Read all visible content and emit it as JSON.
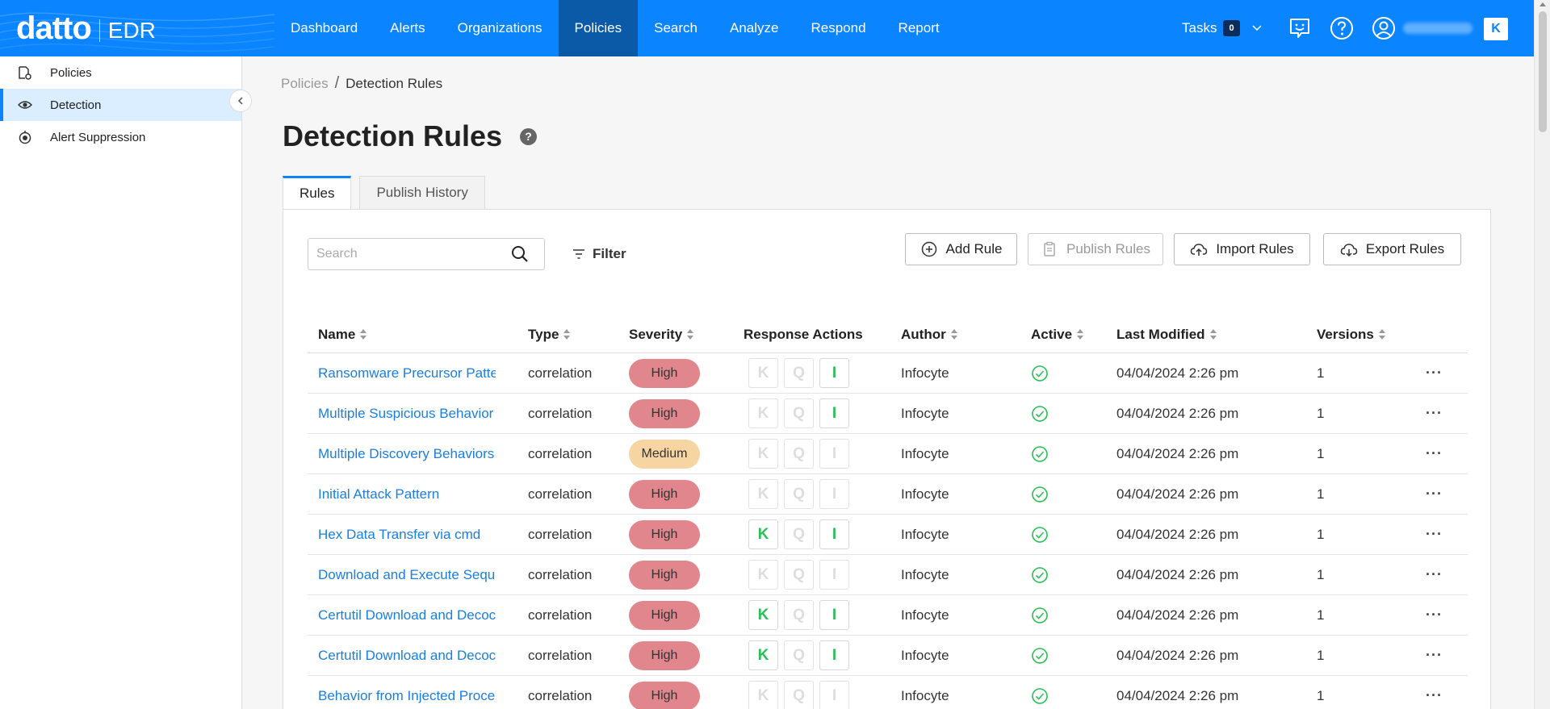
{
  "app": {
    "brand": "datto",
    "product": "EDR"
  },
  "nav": [
    {
      "label": "Dashboard"
    },
    {
      "label": "Alerts"
    },
    {
      "label": "Organizations"
    },
    {
      "label": "Policies"
    },
    {
      "label": "Search"
    },
    {
      "label": "Analyze"
    },
    {
      "label": "Respond"
    },
    {
      "label": "Report"
    }
  ],
  "tasks": {
    "label": "Tasks",
    "count": "0"
  },
  "corner_logo": "K",
  "sidebar": {
    "items": [
      {
        "label": "Policies",
        "icon": "policy-icon"
      },
      {
        "label": "Detection",
        "icon": "eye-icon"
      },
      {
        "label": "Alert Suppression",
        "icon": "suppression-icon"
      }
    ]
  },
  "breadcrumb": {
    "parent": "Policies",
    "separator": "/",
    "current": "Detection Rules"
  },
  "page": {
    "title": "Detection Rules",
    "help": "?"
  },
  "tabs": [
    {
      "label": "Rules"
    },
    {
      "label": "Publish History"
    }
  ],
  "toolbar": {
    "search_placeholder": "Search",
    "filter_label": "Filter",
    "add_rule": "Add Rule",
    "publish_rules": "Publish Rules",
    "import_rules": "Import Rules",
    "export_rules": "Export Rules"
  },
  "table": {
    "columns": {
      "name": "Name",
      "type": "Type",
      "severity": "Severity",
      "response": "Response Actions",
      "author": "Author",
      "active": "Active",
      "modified": "Last Modified",
      "versions": "Versions"
    },
    "response_letters": [
      "K",
      "Q",
      "I"
    ],
    "more": "···",
    "rows": [
      {
        "name": "Ransomware Precursor Patte",
        "type": "correlation",
        "severity": "High",
        "author": "Infocyte",
        "modified": "04/04/2024 2:26 pm",
        "versions": "1"
      },
      {
        "name": "Multiple Suspicious Behavior",
        "type": "correlation",
        "severity": "High",
        "author": "Infocyte",
        "modified": "04/04/2024 2:26 pm",
        "versions": "1"
      },
      {
        "name": "Multiple Discovery Behaviors",
        "type": "correlation",
        "severity": "Medium",
        "author": "Infocyte",
        "modified": "04/04/2024 2:26 pm",
        "versions": "1"
      },
      {
        "name": "Initial Attack Pattern",
        "type": "correlation",
        "severity": "High",
        "author": "Infocyte",
        "modified": "04/04/2024 2:26 pm",
        "versions": "1"
      },
      {
        "name": "Hex Data Transfer via cmd",
        "type": "correlation",
        "severity": "High",
        "author": "Infocyte",
        "modified": "04/04/2024 2:26 pm",
        "versions": "1"
      },
      {
        "name": "Download and Execute Sequ",
        "type": "correlation",
        "severity": "High",
        "author": "Infocyte",
        "modified": "04/04/2024 2:26 pm",
        "versions": "1"
      },
      {
        "name": "Certutil Download and Decoc",
        "type": "correlation",
        "severity": "High",
        "author": "Infocyte",
        "modified": "04/04/2024 2:26 pm",
        "versions": "1"
      },
      {
        "name": "Certutil Download and Decoc",
        "type": "correlation",
        "severity": "High",
        "author": "Infocyte",
        "modified": "04/04/2024 2:26 pm",
        "versions": "1"
      },
      {
        "name": "Behavior from Injected Proce",
        "type": "correlation",
        "severity": "High",
        "author": "Infocyte",
        "modified": "04/04/2024 2:26 pm",
        "versions": "1"
      }
    ],
    "response_active": [
      [
        false,
        false,
        true
      ],
      [
        false,
        false,
        true
      ],
      [
        false,
        false,
        false
      ],
      [
        false,
        false,
        false
      ],
      [
        true,
        false,
        true
      ],
      [
        false,
        false,
        false
      ],
      [
        true,
        false,
        true
      ],
      [
        true,
        false,
        true
      ],
      [
        false,
        false,
        false
      ]
    ]
  },
  "colors": {
    "topbar": "#0a84ff",
    "nav_active": "#0a5aa8",
    "link": "#1a7fe0",
    "severity_high": "#e0868c",
    "severity_medium": "#f7d5a2",
    "response_on": "#2bbf57",
    "active_check": "#2bbf57"
  }
}
